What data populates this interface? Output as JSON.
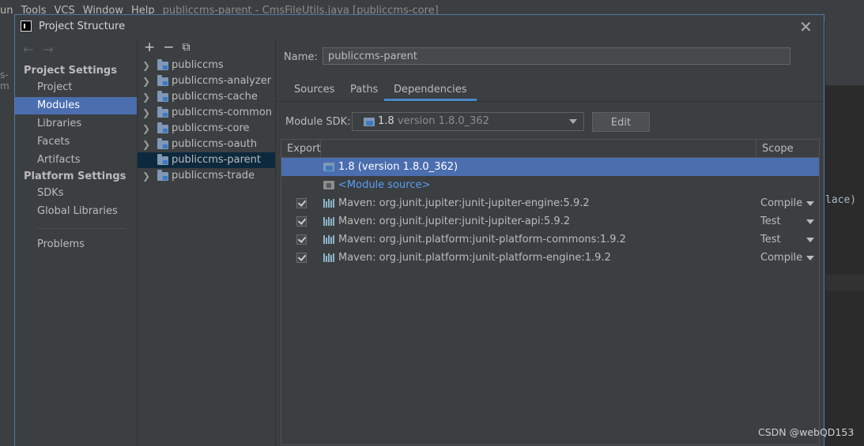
{
  "ide": {
    "menu": [
      "un",
      "Tools",
      "VCS",
      "Window",
      "Help"
    ],
    "window_title": "publiccms-parent - CmsFileUtils.java [publiccms-core]",
    "left_fragment": "s-m",
    "code_fragment": "lace)"
  },
  "dialog": {
    "title": "Project Structure",
    "nav": {
      "project_settings_header": "Project Settings",
      "project_settings_items": [
        "Project",
        "Modules",
        "Libraries",
        "Facets",
        "Artifacts"
      ],
      "platform_settings_header": "Platform Settings",
      "platform_settings_items": [
        "SDKs",
        "Global Libraries"
      ],
      "other_items": [
        "Problems"
      ],
      "selected": "Modules"
    },
    "modules_toolbar": {
      "add": "+",
      "remove": "−",
      "copy": "⧉"
    },
    "modules": [
      {
        "name": "publiccms",
        "expandable": true,
        "selected": false
      },
      {
        "name": "publiccms-analyzer",
        "expandable": true,
        "selected": false
      },
      {
        "name": "publiccms-cache",
        "expandable": true,
        "selected": false
      },
      {
        "name": "publiccms-common",
        "expandable": true,
        "selected": false
      },
      {
        "name": "publiccms-core",
        "expandable": true,
        "selected": false
      },
      {
        "name": "publiccms-oauth",
        "expandable": true,
        "selected": false
      },
      {
        "name": "publiccms-parent",
        "expandable": false,
        "selected": true
      },
      {
        "name": "publiccms-trade",
        "expandable": true,
        "selected": false
      }
    ],
    "name_label": "Name:",
    "name_value": "publiccms-parent",
    "tabs": [
      {
        "label": "Sources",
        "active": false
      },
      {
        "label": "Paths",
        "active": false
      },
      {
        "label": "Dependencies",
        "active": true
      }
    ],
    "sdk": {
      "label": "Module SDK:",
      "name": "1.8",
      "version": "version 1.8.0_362",
      "edit_label": "Edit"
    },
    "dependencies": {
      "headers": {
        "export": "Export",
        "name": "",
        "scope": "Scope"
      },
      "rows": [
        {
          "kind": "sdk",
          "name": "1.8 (version 1.8.0_362)",
          "scope": "",
          "checked": false,
          "selected": true
        },
        {
          "kind": "source",
          "name": "<Module source>",
          "scope": "",
          "checked": false,
          "selected": false
        },
        {
          "kind": "maven",
          "name": "Maven: org.junit.jupiter:junit-jupiter-engine:5.9.2",
          "scope": "Compile",
          "checked": true,
          "selected": false
        },
        {
          "kind": "maven",
          "name": "Maven: org.junit.jupiter:junit-jupiter-api:5.9.2",
          "scope": "Test",
          "checked": true,
          "selected": false
        },
        {
          "kind": "maven",
          "name": "Maven: org.junit.platform:junit-platform-commons:1.9.2",
          "scope": "Test",
          "checked": true,
          "selected": false
        },
        {
          "kind": "maven",
          "name": "Maven: org.junit.platform:junit-platform-engine:1.9.2",
          "scope": "Compile",
          "checked": true,
          "selected": false
        }
      ]
    }
  },
  "watermark": "CSDN @webQD153"
}
